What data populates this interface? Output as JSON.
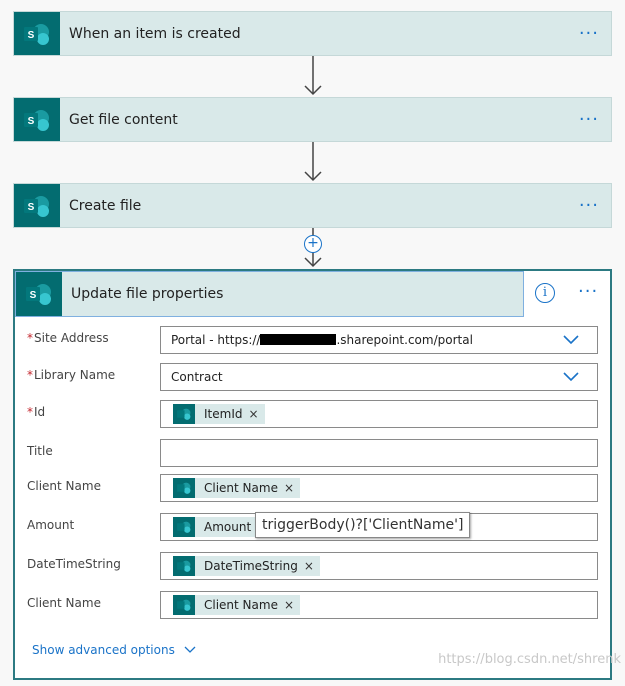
{
  "flow": {
    "cards": [
      {
        "title": "When an item is created",
        "menu": "···"
      },
      {
        "title": "Get file content",
        "menu": "···"
      },
      {
        "title": "Create file",
        "menu": "···"
      }
    ],
    "insert_step": "+"
  },
  "action": {
    "title": "Update file properties",
    "info": "i",
    "menu": "···",
    "fields": {
      "site_address": {
        "label": "Site Address",
        "required": "*",
        "value_prefix": "Portal - https://",
        "value_suffix": ".sharepoint.com/portal"
      },
      "library_name": {
        "label": "Library Name",
        "required": "*",
        "value": "Contract"
      },
      "id": {
        "label": "Id",
        "required": "*",
        "token": "ItemId"
      },
      "title": {
        "label": "Title"
      },
      "client_name": {
        "label": "Client Name",
        "token": "Client Name"
      },
      "amount": {
        "label": "Amount",
        "token": "Amount"
      },
      "datetime": {
        "label": "DateTimeString",
        "token": "DateTimeString"
      },
      "client_name2": {
        "label": "Client Name",
        "token": "Client Name"
      }
    },
    "token_remove": "×",
    "tooltip": "triggerBody()?['ClientName']",
    "advanced_options": "Show advanced options"
  },
  "watermark": "https://blog.csdn.net/shrenk",
  "colors": {
    "sharepoint_teal": "#036c70",
    "card_bg": "#d9e9e9",
    "accent_blue": "#1a73c8",
    "required_red": "#c4262e"
  }
}
